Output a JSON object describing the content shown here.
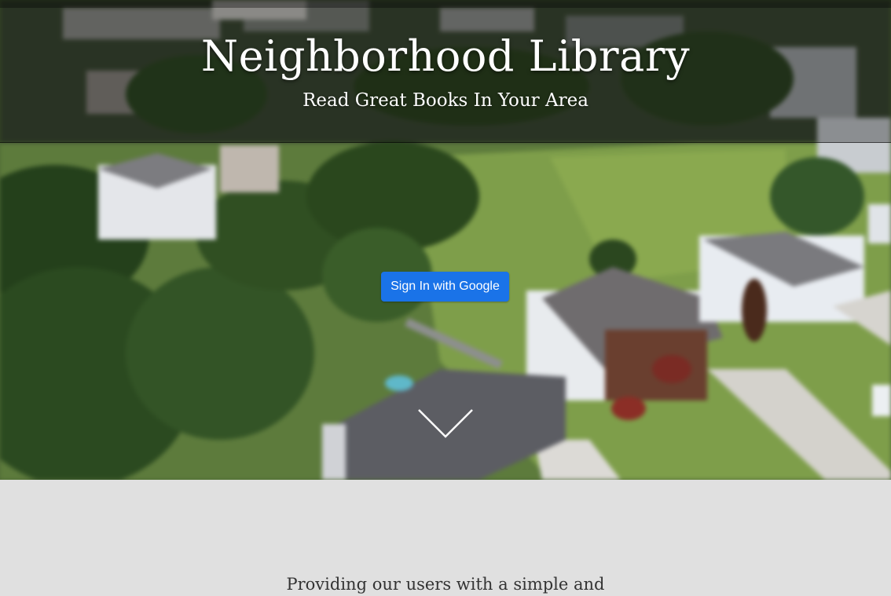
{
  "hero": {
    "title": "Neighborhood Library",
    "subtitle": "Read Great Books In Your Area",
    "signin_label": "Sign In with Google",
    "background_image": "aerial-neighborhood-photo",
    "scroll_icon": "chevron-down-icon"
  },
  "intro": {
    "text": "Providing our users with a simple and"
  },
  "colors": {
    "button": "#1a73e8",
    "section_background": "#e0e0e0",
    "title": "#ffffff"
  }
}
